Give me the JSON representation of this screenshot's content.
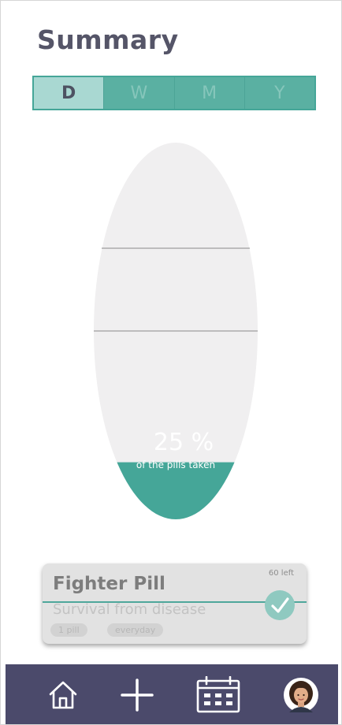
{
  "page": {
    "title": "Summary"
  },
  "period_tabs": {
    "items": [
      {
        "label": "D",
        "active": true
      },
      {
        "label": "W",
        "active": false
      },
      {
        "label": "M",
        "active": false
      },
      {
        "label": "Y",
        "active": false
      }
    ]
  },
  "progress": {
    "value_label": "25 %",
    "caption": "of the pills taken",
    "fraction_taken": 0.25,
    "fill_color": "#45a698",
    "empty_color": "#f0eff0"
  },
  "medication_card": {
    "remaining": "60 left",
    "name": "Fighter Pill",
    "description": "Survival from disease",
    "dose_tag": "1 pill",
    "frequency_tag": "everyday",
    "taken": true,
    "check_icon": "check-icon"
  },
  "bottom_nav": {
    "items": [
      {
        "icon": "home-icon"
      },
      {
        "icon": "plus-icon"
      },
      {
        "icon": "calendar-icon"
      },
      {
        "icon": "avatar"
      }
    ],
    "background": "#4b4a6b"
  }
}
